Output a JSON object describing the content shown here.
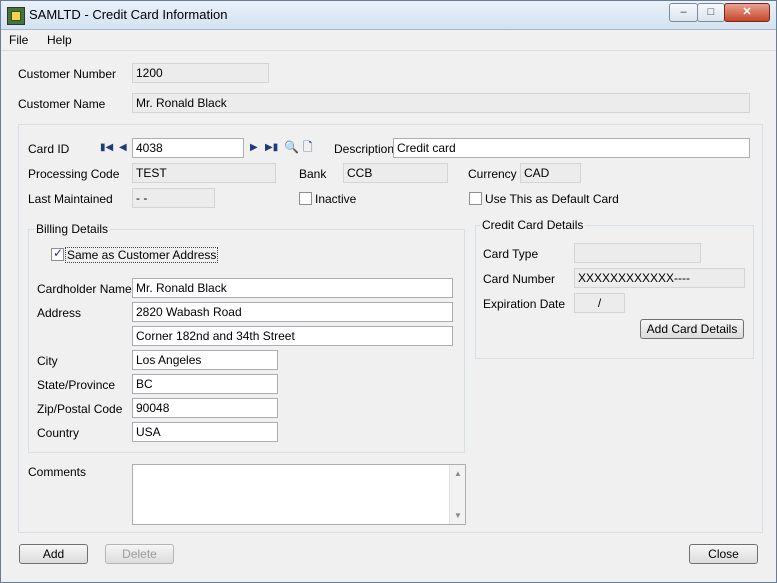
{
  "window": {
    "title": "SAMLTD - Credit Card Information",
    "controls": {
      "minimize": "–",
      "maximize": "□",
      "close": "✕"
    },
    "icon": "accpac-app-icon"
  },
  "menu": {
    "items": [
      "File",
      "Help"
    ]
  },
  "customer": {
    "number_label": "Customer Number",
    "number_value": "1200",
    "name_label": "Customer Name",
    "name_value": "Mr. Ronald Black"
  },
  "card": {
    "id_label": "Card ID",
    "id_value": "4038",
    "description_label": "Description",
    "description_value": "Credit card",
    "processing_code_label": "Processing Code",
    "processing_code_value": "TEST",
    "bank_label": "Bank",
    "bank_value": "CCB",
    "currency_label": "Currency",
    "currency_value": "CAD",
    "last_maintained_label": "Last Maintained",
    "last_maintained_value": "-  -",
    "inactive_label": "Inactive",
    "inactive_checked": false,
    "default_label": "Use This as Default Card",
    "default_checked": false,
    "nav_icons": [
      "first-record-icon",
      "previous-record-icon",
      "next-record-icon",
      "last-record-icon",
      "finder-icon",
      "new-document-icon"
    ]
  },
  "billing": {
    "title": "Billing Details",
    "same_as_label": "Same as Customer Address",
    "same_as_checked": true,
    "cardholder_label": "Cardholder Name",
    "cardholder_value": "Mr. Ronald Black",
    "address_label": "Address",
    "address1_value": "2820 Wabash Road",
    "address2_value": "Corner 182nd and 34th Street",
    "city_label": "City",
    "city_value": "Los Angeles",
    "state_label": "State/Province",
    "state_value": "BC",
    "zip_label": "Zip/Postal Code",
    "zip_value": "90048",
    "country_label": "Country",
    "country_value": "USA"
  },
  "cc_details": {
    "title": "Credit Card Details",
    "type_label": "Card Type",
    "type_value": "",
    "number_label": "Card Number",
    "number_value": "XXXXXXXXXXXX----",
    "expiration_label": "Expiration Date",
    "expiration_value": "/",
    "add_button": "Add Card Details"
  },
  "comments": {
    "label": "Comments",
    "value": ""
  },
  "buttons": {
    "add": "Add",
    "delete": "Delete",
    "close": "Close"
  }
}
